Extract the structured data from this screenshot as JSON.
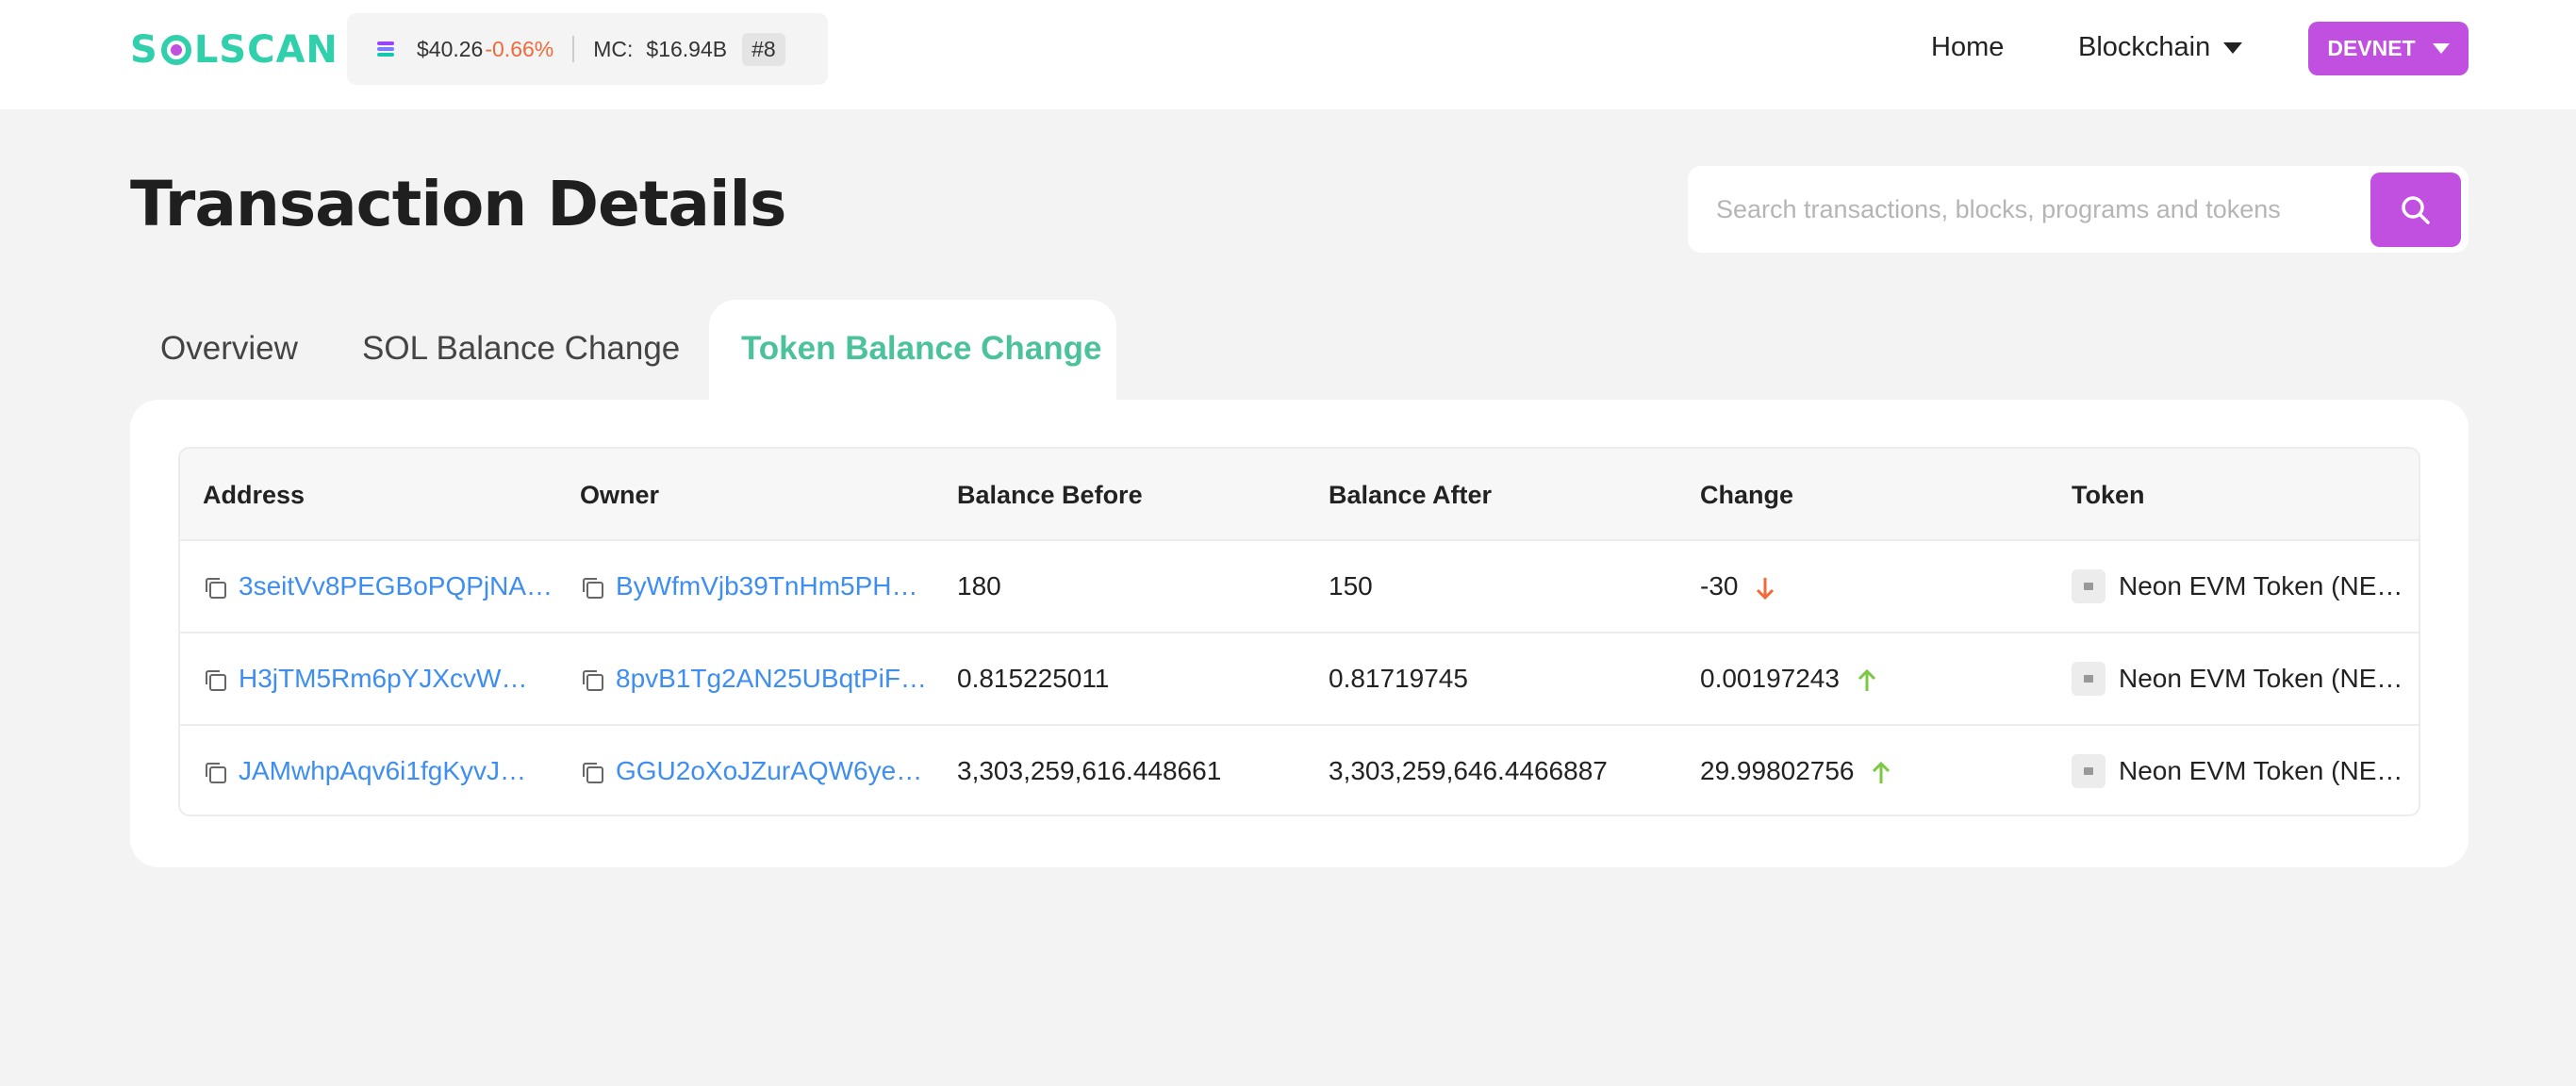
{
  "header": {
    "logo_text": "SOLSCAN",
    "sol_price": "$40.26",
    "sol_change": "-0.66%",
    "mc_label": "MC:",
    "mc_value": "$16.94B",
    "rank": "#8",
    "nav_home": "Home",
    "nav_blockchain": "Blockchain",
    "network": "DEVNET"
  },
  "page": {
    "title": "Transaction Details"
  },
  "search": {
    "placeholder": "Search transactions, blocks, programs and tokens"
  },
  "tabs": [
    {
      "label": "Overview",
      "active": false
    },
    {
      "label": "SOL Balance Change",
      "active": false
    },
    {
      "label": "Token Balance Change",
      "active": true
    }
  ],
  "table": {
    "headers": [
      "Address",
      "Owner",
      "Balance Before",
      "Balance After",
      "Change",
      "Token"
    ],
    "rows": [
      {
        "address": "3seitVv8PEGBoPQPjNA…",
        "owner": "ByWfmVjb39TnHm5PH…",
        "balance_before": "180",
        "balance_after": "150",
        "change": "-30",
        "direction": "down",
        "token": "Neon EVM Token (NE…"
      },
      {
        "address": "H3jTM5Rm6pYJXcvW…",
        "owner": "8pvB1Tg2AN25UBqtPiF…",
        "balance_before": "0.815225011",
        "balance_after": "0.81719745",
        "change": "0.00197243",
        "direction": "up",
        "token": "Neon EVM Token (NE…"
      },
      {
        "address": "JAMwhpAqv6i1fgKyvJ…",
        "owner": "GGU2oXoJZurAQW6ye…",
        "balance_before": "3,303,259,616.448661",
        "balance_after": "3,303,259,646.4466887",
        "change": "29.99802756",
        "direction": "up",
        "token": "Neon EVM Token (NE…"
      }
    ]
  },
  "colors": {
    "brand_green": "#2fd0ab",
    "accent_purple": "#c14fe0",
    "link_blue": "#3d8ef0",
    "down_red": "#f06a3a",
    "up_green": "#7ac943"
  }
}
